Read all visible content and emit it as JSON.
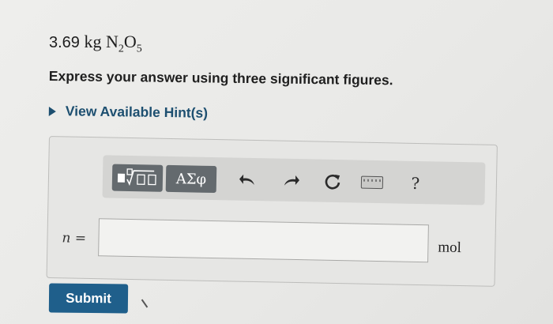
{
  "problem": {
    "quantity": "3.69",
    "unit": "kg",
    "formula": "N",
    "sub1": "2",
    "o": "O",
    "sub2": "5"
  },
  "instruction": "Express your answer using three significant figures.",
  "hint": {
    "label": "View Available Hint(s)"
  },
  "toolbar": {
    "template_icon": "templates-sqrt-icon",
    "greek_label": "ΑΣφ",
    "undo_icon": "undo-icon",
    "redo_icon": "redo-icon",
    "reset_icon": "reset-icon",
    "keyboard_icon": "keyboard-icon",
    "help_label": "?"
  },
  "answer": {
    "variable": "n",
    "equals": "=",
    "value": "",
    "unit": "mol"
  },
  "submit": {
    "label": "Submit"
  }
}
